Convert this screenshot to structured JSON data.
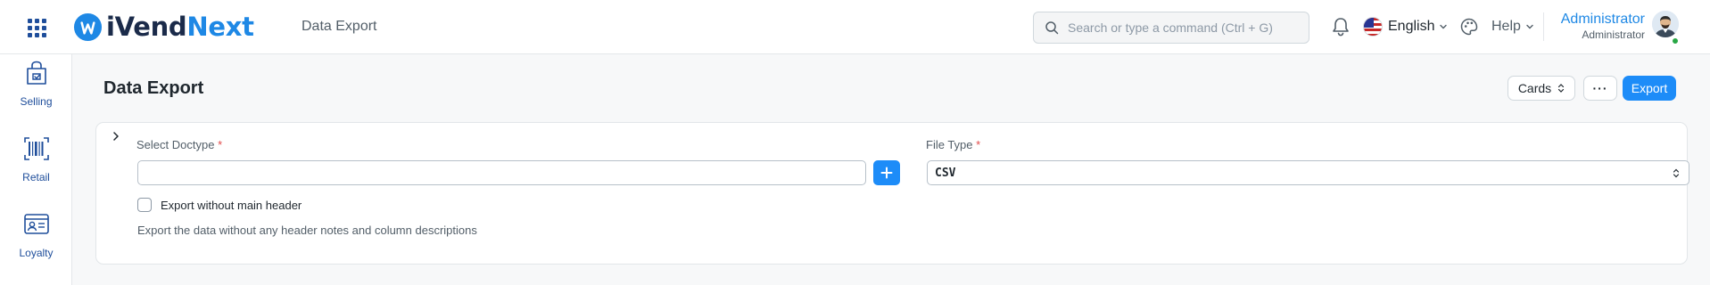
{
  "navbar": {
    "brand_part1": "iVend",
    "brand_part2": "Next",
    "page_title": "Data Export",
    "search_placeholder": "Search or type a command (Ctrl + G)",
    "language": "English",
    "help": "Help",
    "user_name": "Administrator",
    "user_role": "Administrator",
    "icons": [
      "apps-grid-icon",
      "search-icon",
      "bell-icon",
      "us-flag-icon",
      "chevron-down-icon",
      "theme-palette-icon",
      "avatar"
    ]
  },
  "sidebar": {
    "items": [
      {
        "label": "Selling",
        "icon": "shopping-bag-icon"
      },
      {
        "label": "Retail",
        "icon": "barcode-icon"
      },
      {
        "label": "Loyalty",
        "icon": "id-card-icon"
      }
    ]
  },
  "page": {
    "title": "Data Export",
    "cards_button": "Cards",
    "more_button": "···",
    "export_button": "Export"
  },
  "form": {
    "doctype_label": "Select Doctype",
    "doctype_value": "",
    "required_marker": "*",
    "file_type_label": "File Type",
    "file_type_value": "CSV",
    "export_without_header_label": "Export without main header",
    "export_without_header_checked": false,
    "export_without_header_description": "Export the data without any header notes and column descriptions"
  },
  "colors": {
    "primary": "#1d8cf8",
    "brand_dark": "#1b2b4a",
    "brand_blue": "#1e88e5",
    "required": "#e24c4c",
    "online": "#28a745"
  }
}
